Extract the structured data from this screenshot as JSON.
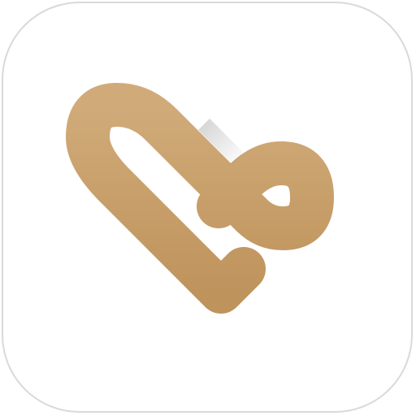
{
  "app_icon": {
    "name": "heart-loop-app-icon",
    "icon": "heart-loop-icon",
    "colors": {
      "background": "#ffffff",
      "border": "#d9d9d9",
      "gold_light": "#d0ab79",
      "gold_dark": "#bf935c",
      "gold_shadow": "#a57c49"
    }
  }
}
